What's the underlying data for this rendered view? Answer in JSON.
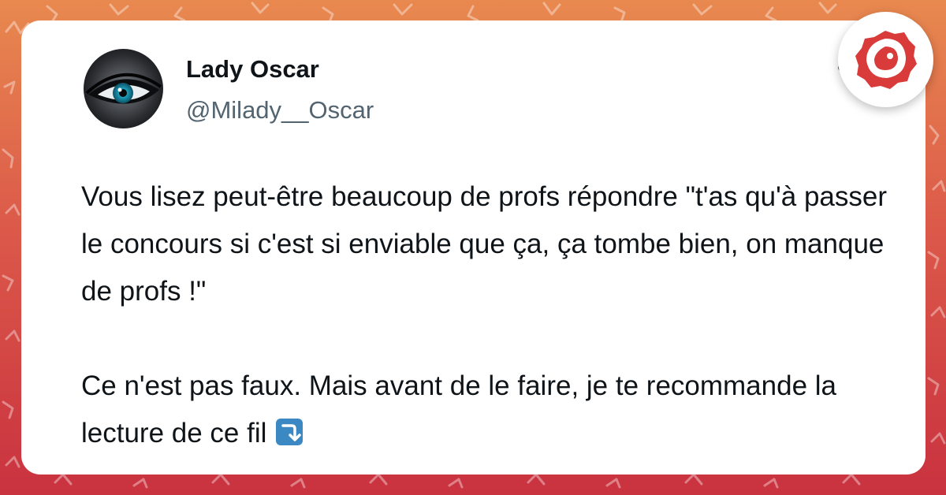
{
  "tweet": {
    "author_name": "Lady Oscar",
    "author_handle": "@Milady__Oscar",
    "paragraph1": "Vous lisez peut-être beaucoup de profs répondre \"t'as qu'à passer le concours si c'est si enviable que ça, ça tombe bien, on manque de profs !\"",
    "paragraph2": "Ce n'est pas faux. Mais avant de le faire, je te recommande la lecture de ce fil",
    "trailing_emoji": "arrow-right-curving-down-icon"
  },
  "colors": {
    "background_top": "#e8894f",
    "background_bottom": "#c9323f",
    "card": "#ffffff",
    "name_text": "#0f1419",
    "handle_text": "#536471",
    "brand_red": "#d93a3a"
  }
}
